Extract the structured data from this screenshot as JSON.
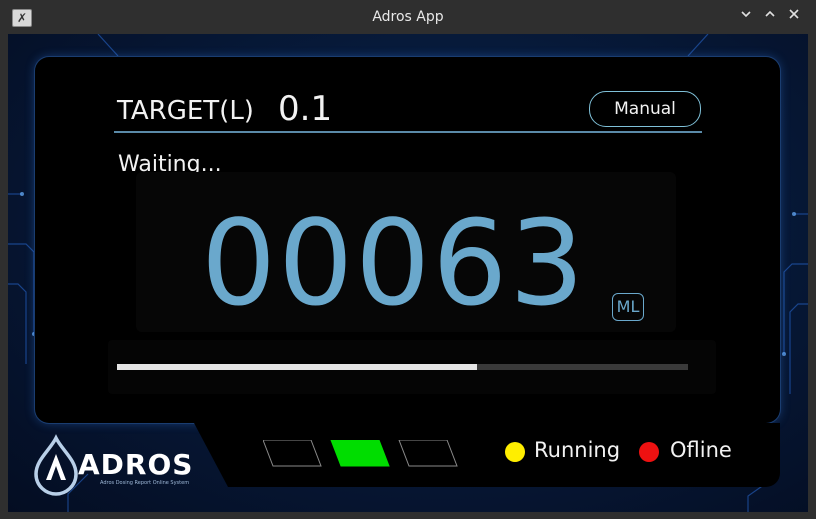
{
  "window": {
    "title": "Adros App",
    "controls": [
      "minimize",
      "maximize",
      "close"
    ]
  },
  "header": {
    "target_label": "TARGET(L)",
    "target_value": "0.1",
    "manual_button": "Manual"
  },
  "status": {
    "text": "Waiting..."
  },
  "counter": {
    "value": "00063",
    "unit": "ML"
  },
  "progress": {
    "fraction": 0.63
  },
  "logo": {
    "word": "ADROS",
    "tagline": "Adros Dosing Report Online System"
  },
  "indicators": {
    "active_index": 1,
    "active_color": "#00dd00",
    "count": 3
  },
  "legend": {
    "running_label": "Running",
    "running_color": "#ffee00",
    "offline_label": "Ofline",
    "offline_color": "#ee1111"
  }
}
